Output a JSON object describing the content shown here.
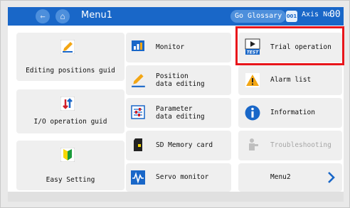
{
  "header": {
    "title": "Menu1",
    "back_icon": "left-arrow-icon",
    "home_icon": "home-icon",
    "glossary_label": "Go Glossary",
    "axis_label": "Axis No.",
    "axis_value": "00",
    "bg": "#1967c8"
  },
  "left_tiles": [
    {
      "label": "Editing positions guid",
      "icon": "pencil-icon"
    },
    {
      "label": "I/O operation guid",
      "icon": "io-arrows-icon"
    },
    {
      "label": "Easy Setting",
      "icon": "beginner-mark-icon"
    }
  ],
  "mid_tiles": [
    {
      "label": "Monitor",
      "icon": "monitor-chart-icon"
    },
    {
      "label": "Position\ndata editing",
      "icon": "pencil-icon"
    },
    {
      "label": "Parameter\ndata editing",
      "icon": "parameter-sliders-icon"
    },
    {
      "label": "SD Memory card",
      "icon": "sd-card-icon"
    },
    {
      "label": "Servo monitor",
      "icon": "waveform-icon"
    }
  ],
  "right_tiles": [
    {
      "label": "Trial operation",
      "icon": "test-play-icon"
    },
    {
      "label": "Alarm list",
      "icon": "warning-icon"
    },
    {
      "label": "Information",
      "icon": "info-icon"
    },
    {
      "label": "Troubleshooting",
      "icon": "troubleshooting-icon"
    },
    {
      "label": "Menu2",
      "icon": "chevron-right-icon"
    }
  ],
  "colors": {
    "accent": "#1967c8",
    "highlight": "#e8151b",
    "disabled_text": "#a6a6a6"
  }
}
